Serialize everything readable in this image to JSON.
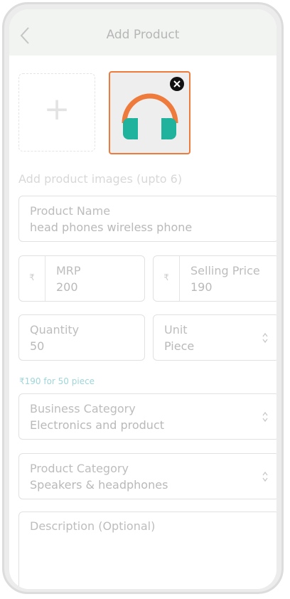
{
  "header": {
    "title": "Add Product",
    "back_icon": "chevron-left-icon"
  },
  "images": {
    "add_icon": "plus-icon",
    "thumbnail_icon": "headphones-icon",
    "remove_icon": "close-circle-icon",
    "hint": "Add product images (upto 6)"
  },
  "product_name": {
    "label": "Product Name",
    "value": "head phones wireless phone"
  },
  "mrp": {
    "currency": "₹",
    "label": "MRP",
    "value": "200"
  },
  "selling_price": {
    "currency": "₹",
    "label": "Selling Price",
    "value": "190"
  },
  "quantity": {
    "label": "Quantity",
    "value": "50"
  },
  "unit": {
    "label": "Unit",
    "value": "Piece"
  },
  "price_note": "₹190 for 50 piece",
  "business_category": {
    "label": "Business Category",
    "value": "Electronics and product"
  },
  "product_category": {
    "label": "Product Category",
    "value": "Speakers & headphones"
  },
  "description": {
    "placeholder": "Description (Optional)"
  },
  "colors": {
    "accent_orange": "#ee7a3c",
    "headphone_teal": "#1fb29c",
    "note_teal": "#9fd6d9",
    "header_bg": "#f2f4f2"
  }
}
